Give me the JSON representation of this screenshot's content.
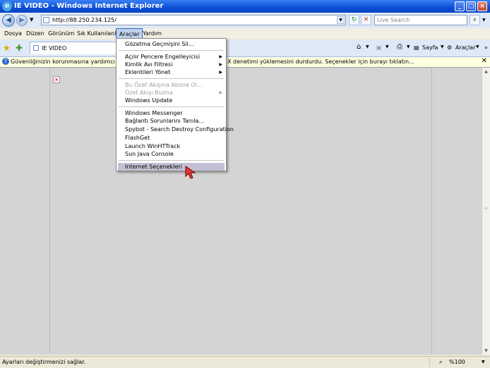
{
  "window": {
    "title": "IE VIDEO - Windows Internet Explorer"
  },
  "address": {
    "url": "http://88.250.234.125/",
    "search_placeholder": "Live Search"
  },
  "menubar": [
    "Dosya",
    "Düzen",
    "Görünüm",
    "Sık Kullanılanlar",
    "Araçlar",
    "Yardım"
  ],
  "tab": {
    "title": "IE VIDEO"
  },
  "toolbar": {
    "page_label": "Sayfa",
    "tools_label": "Araçlar"
  },
  "infobar": {
    "text_left": "Güvenliğinizin korunmasına yardımcı olmak için",
    "text_right": "X denetimi yüklemesini durdurdu. Seçenekler için burayı tıklatın..."
  },
  "tools_menu": {
    "item1": "Gözatma Geçmişini Sil...",
    "item2": "Açılır Pencere Engelleyicisi",
    "item3": "Kimlik Avı Filtresi",
    "item4": "Eklentileri Yönet",
    "item5": "Bu Özet Akışına Abone Ol...",
    "item6": "Özet Akışı Bulma",
    "item7": "Windows Update",
    "item8": "Windows Messenger",
    "item9": "Bağlantı Sorunlarını Tanıla...",
    "item10": "Spybot - Search  Destroy Configuration",
    "item11": "FlashGet",
    "item12": "Launch WinHTTrack",
    "item13": "Sun Java Console",
    "item14": "Internet Seçenekleri"
  },
  "status": {
    "text": "Ayarları değiştirmenizi sağlar.",
    "zoom": "%100"
  },
  "colors": {
    "titlebar": "#0a4fd6",
    "menu_highlight": "#c1c1d3",
    "infobar": "#ffffe1"
  }
}
